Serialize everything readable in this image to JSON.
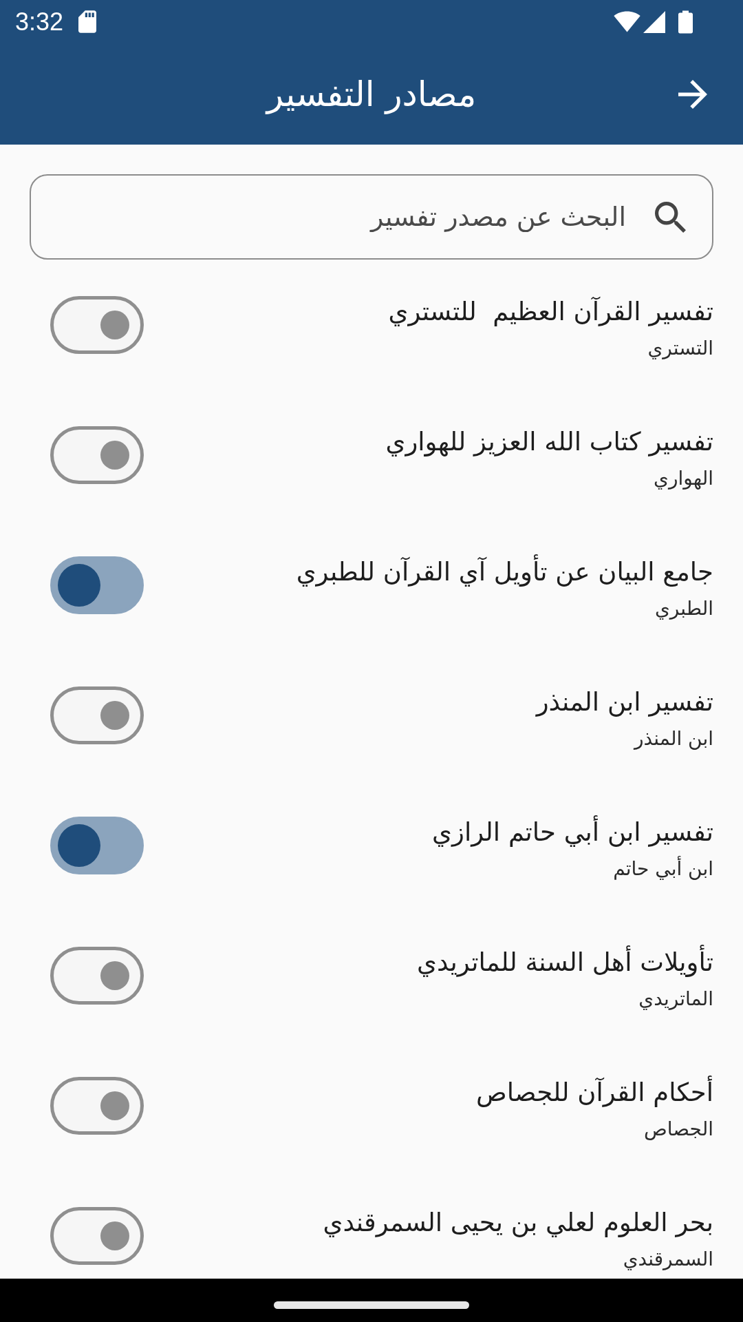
{
  "status_bar": {
    "time": "3:32"
  },
  "app_bar": {
    "title": "مصادر التفسير"
  },
  "search": {
    "placeholder": "البحث عن مصدر تفسير"
  },
  "sources": [
    {
      "title": "تفسير القرآن العظيم  للتستري",
      "author": "التستري",
      "on": false
    },
    {
      "title": "تفسير كتاب الله العزيز للهواري",
      "author": "الهواري",
      "on": false
    },
    {
      "title": "جامع البيان عن تأويل آي القرآن للطبري",
      "author": "الطبري",
      "on": true
    },
    {
      "title": "تفسير ابن المنذر",
      "author": "ابن المنذر",
      "on": false
    },
    {
      "title": "تفسير ابن أبي حاتم الرازي",
      "author": "ابن أبي حاتم",
      "on": true
    },
    {
      "title": "تأويلات أهل السنة للماتريدي",
      "author": "الماتريدي",
      "on": false
    },
    {
      "title": "أحكام القرآن للجصاص",
      "author": "الجصاص",
      "on": false
    },
    {
      "title": "بحر العلوم لعلي بن يحيى السمرقندي",
      "author": "السمرقندي",
      "on": false
    }
  ]
}
